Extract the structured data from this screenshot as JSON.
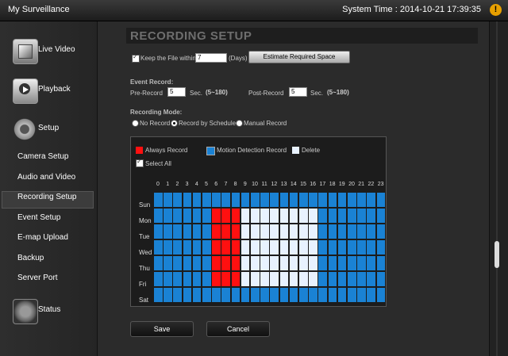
{
  "window": {
    "title": "My Surveillance",
    "system_time": "System Time : 2014-10-21 17:39:35",
    "alert_icon": "warning-icon"
  },
  "sidebar": {
    "main_items": [
      {
        "label": "Live Video",
        "icon": "live-video-icon"
      },
      {
        "label": "Playback",
        "icon": "playback-icon"
      },
      {
        "label": "Setup",
        "icon": "gear-icon"
      },
      {
        "label": "Status",
        "icon": "status-icon"
      }
    ],
    "setup_items": [
      "Camera Setup",
      "Audio and Video",
      "Recording Setup",
      "Event Setup",
      "E-map Upload",
      "Backup",
      "Server Port"
    ],
    "selected": "Recording Setup"
  },
  "page": {
    "title": "RECORDING SETUP",
    "keep_file_label": "Keep the File within",
    "keep_file_value": "7",
    "days_label": "(Days)",
    "estimate_button": "Estimate Required Space",
    "event_record_label": "Event Record:",
    "pre_record_label": "Pre-Record",
    "pre_record_value": "5",
    "post_record_label": "Post-Record",
    "post_record_value": "5",
    "sec_label": "Sec.",
    "range_label": "(5~180)",
    "recording_mode_label": "Recording Mode:",
    "modes": [
      "No Record",
      "Record by Schedule",
      "Manual Record"
    ],
    "selected_mode": "Record by Schedule",
    "legend": {
      "always": "Always Record",
      "motion": "Motion Detection Record",
      "delete": "Delete",
      "select_all": "Select All"
    },
    "colors": {
      "always": "#ff1010",
      "motion": "#1a82d4",
      "delete": "#e8f2ff"
    },
    "hours": [
      "0",
      "1",
      "2",
      "3",
      "4",
      "5",
      "6",
      "7",
      "8",
      "9",
      "10",
      "11",
      "12",
      "13",
      "14",
      "15",
      "16",
      "17",
      "18",
      "19",
      "20",
      "21",
      "22",
      "23"
    ],
    "days": [
      "Sun",
      "Mon",
      "Tue",
      "Wed",
      "Thu",
      "Fri",
      "Sat"
    ],
    "schedule": [
      "MMMMMMMMMMMMMMMMMMMMMMMM",
      "MMMMMMAAADDDDDDDDMMMMMMM",
      "MMMMMMAAADDDDDDDDMMMMMMM",
      "MMMMMMAAADDDDDDDDMMMMMMM",
      "MMMMMMAAADDDDDDDDMMMMMMM",
      "MMMMMMAAADDDDDDDDMMMMMMM",
      "MMMMMMMMMMMMMMMMMMMMMMMM"
    ],
    "save_button": "Save",
    "cancel_button": "Cancel"
  }
}
